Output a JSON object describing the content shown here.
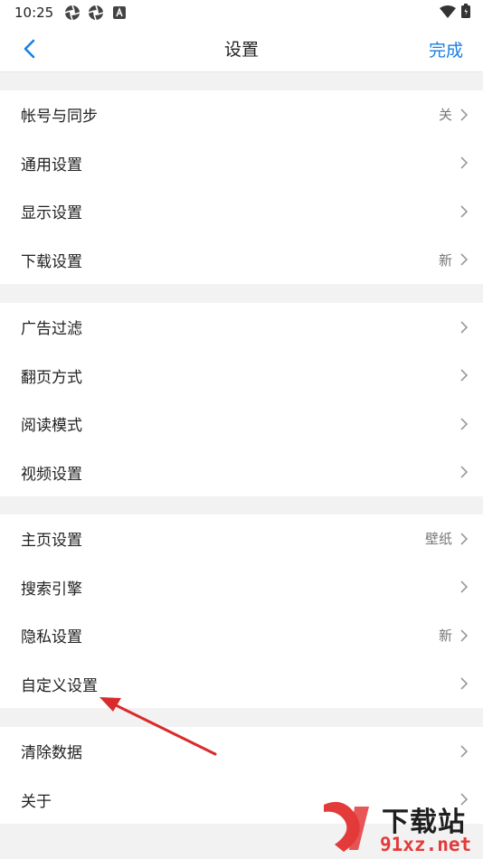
{
  "status_bar": {
    "time": "10:25"
  },
  "header": {
    "title": "设置",
    "done_label": "完成"
  },
  "sections": [
    {
      "items": [
        {
          "label": "帐号与同步",
          "value": "关"
        },
        {
          "label": "通用设置",
          "value": ""
        },
        {
          "label": "显示设置",
          "value": ""
        },
        {
          "label": "下载设置",
          "value": "新"
        }
      ]
    },
    {
      "items": [
        {
          "label": "广告过滤",
          "value": ""
        },
        {
          "label": "翻页方式",
          "value": ""
        },
        {
          "label": "阅读模式",
          "value": ""
        },
        {
          "label": "视频设置",
          "value": ""
        }
      ]
    },
    {
      "items": [
        {
          "label": "主页设置",
          "value": "壁纸"
        },
        {
          "label": "搜索引擎",
          "value": ""
        },
        {
          "label": "隐私设置",
          "value": "新"
        },
        {
          "label": "自定义设置",
          "value": ""
        }
      ]
    },
    {
      "items": [
        {
          "label": "清除数据",
          "value": ""
        },
        {
          "label": "关于",
          "value": ""
        }
      ]
    }
  ],
  "watermark": {
    "text_top": "下载站",
    "text_bottom": "91xz.net"
  },
  "colors": {
    "accent": "#1a7fe3",
    "annotation_arrow": "#d92b2b",
    "background": "#f2f2f2"
  }
}
